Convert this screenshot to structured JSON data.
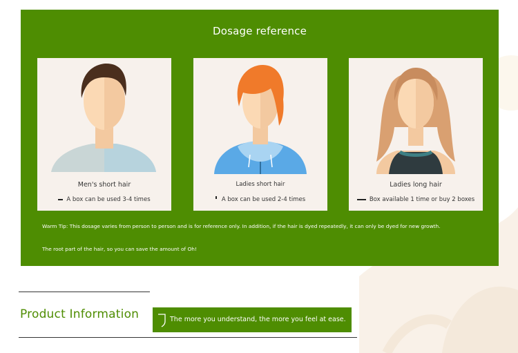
{
  "dosage": {
    "title": "Dosage reference",
    "cards": [
      {
        "label": "Men's short hair",
        "note": "A box can be used 3-4 times"
      },
      {
        "label": "Ladies short hair",
        "note": "A box can be used 2-4 times"
      },
      {
        "label": "Ladies long hair",
        "note": "Box available 1 time or buy 2 boxes"
      }
    ],
    "tip_line_1": "Warm Tip: This dosage varies from person to person and is for reference only. In addition, if the hair is dyed repeatedly, it can only be dyed for new growth.",
    "tip_line_2": "The root part of the hair, so you can save the amount of Oh!"
  },
  "product": {
    "title": "Product Information",
    "badge_text": "The more you understand, the more you feel at ease."
  },
  "colors": {
    "brand_green": "#4e8d02",
    "card_background": "#f7f1ec"
  }
}
